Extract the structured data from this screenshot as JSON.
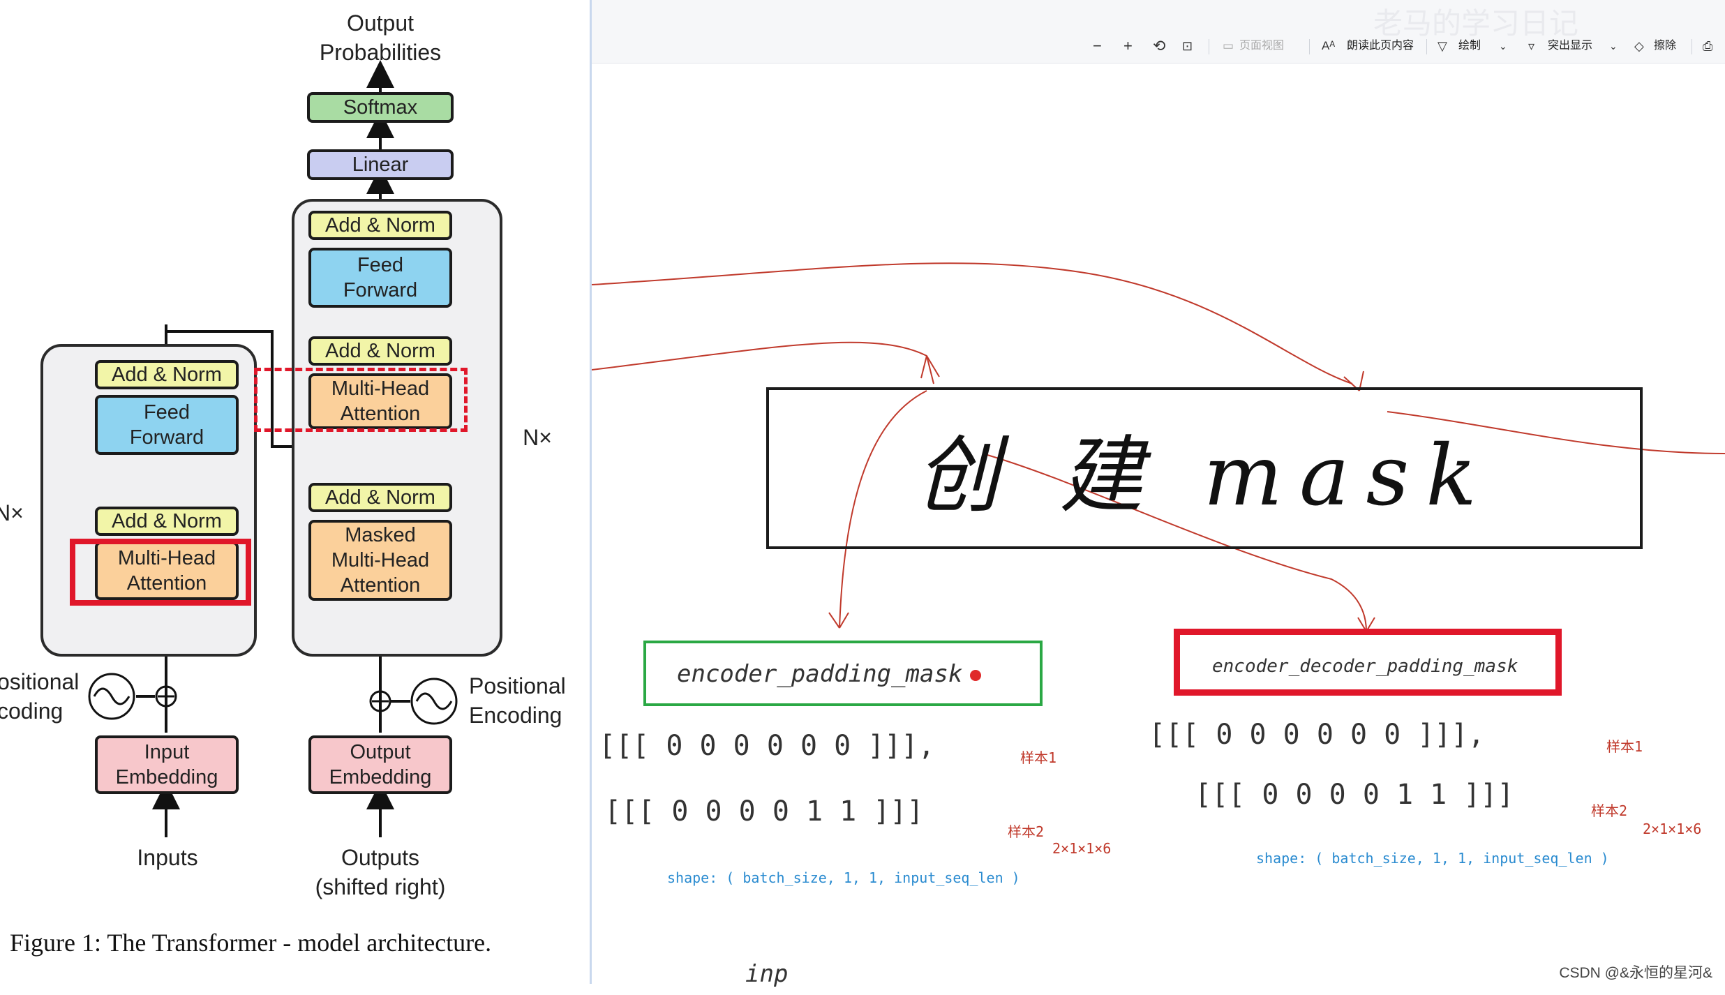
{
  "paper": {
    "output_probabilities": [
      "Output",
      "Probabilities"
    ],
    "softmax": "Softmax",
    "linear": "Linear",
    "add_norm": "Add & Norm",
    "feed_forward": [
      "Feed",
      "Forward"
    ],
    "multi_head_attention": [
      "Multi-Head",
      "Attention"
    ],
    "masked_mha": [
      "Masked",
      "Multi-Head",
      "Attention"
    ],
    "nx": "N×",
    "positional_encoding_left": [
      "ositional",
      "coding"
    ],
    "positional_encoding_right": [
      "Positional",
      "Encoding"
    ],
    "input_embedding": [
      "Input",
      "Embedding"
    ],
    "output_embedding": [
      "Output",
      "Embedding"
    ],
    "inputs": "Inputs",
    "outputs": [
      "Outputs",
      "(shifted right)"
    ],
    "caption": "Figure 1: The Transformer - model architecture."
  },
  "toolbar": {
    "page_view": "页面视图",
    "read_aloud": "朗读此页内容",
    "draw": "绘制",
    "highlight": "突出显示",
    "erase": "擦除",
    "blurred_title": "老马的学习日记"
  },
  "canvas": {
    "title": "创 建 mask",
    "encoder_label": "encoder_padding_mask",
    "decoder_label": "encoder_decoder_padding_mask",
    "enc_row1": "[[[ 0   0   0   0   0   0 ]]],",
    "enc_row2": "[[[ 0   0   0   0   1   1 ]]]",
    "sample1": "样本1",
    "sample2": "样本2",
    "enc_dims": "2×1×1×6",
    "enc_shape": "shape: ( batch_size, 1, 1, input_seq_len )",
    "dec_row1": "[[[ 0   0   0   0   0   0 ]]],",
    "dec_row2": "[[[ 0   0   0   0   1   1 ]]]",
    "dec_dims": "2×1×1×6",
    "dec_shape": "shape: ( batch_size, 1, 1, input_seq_len )",
    "inp": "inp"
  },
  "watermark": "CSDN @&永恒的星河&",
  "colors": {
    "red_box": "#e0172a",
    "green_box": "#2aa844",
    "pen_red": "#c0392b",
    "pen_blue": "#2a8bd0",
    "pen_green": "#22a03a"
  },
  "icons": [
    "zoom-out-icon",
    "zoom-in-icon",
    "rotate-icon",
    "fit-icon",
    "page-view-icon",
    "read-aloud-icon",
    "draw-icon",
    "highlight-icon",
    "eraser-icon",
    "print-icon"
  ]
}
